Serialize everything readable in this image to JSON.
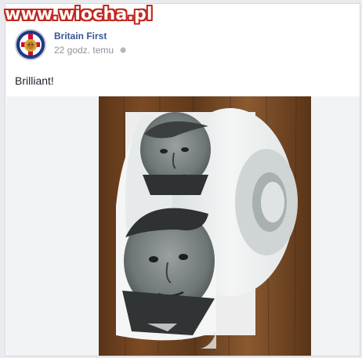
{
  "watermark": {
    "text": "www.wiocha.pl"
  },
  "post": {
    "author": "Britain First",
    "timestamp": "22 godz. temu",
    "privacy_icon": "globe-gear-icon",
    "text": "Brilliant!"
  },
  "colors": {
    "link_blue": "#365899",
    "meta_gray": "#90949c",
    "watermark_red": "#c0281f"
  }
}
